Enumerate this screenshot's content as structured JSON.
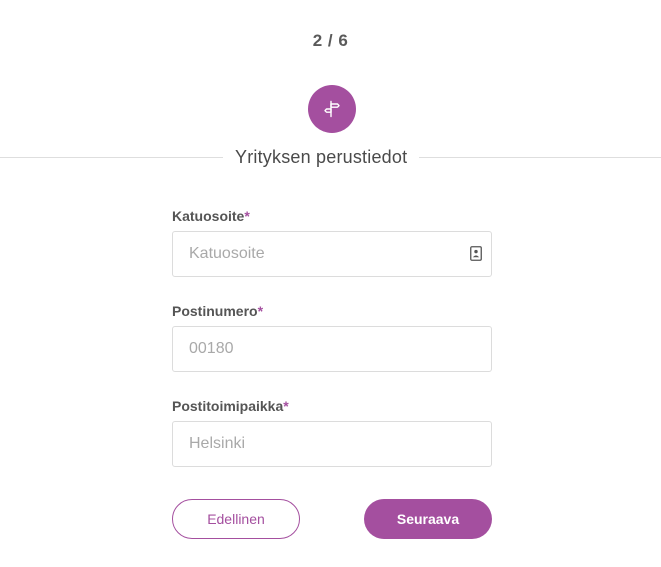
{
  "progress": {
    "step_text": "2 / 6",
    "current_step": 2,
    "total_steps": 6
  },
  "section": {
    "icon": "signpost-icon",
    "title": "Yrityksen perustiedot"
  },
  "fields": {
    "street": {
      "label": "Katuosoite",
      "required_mark": "*",
      "placeholder": "Katuosoite",
      "icon": "contact-card-icon"
    },
    "postal_code": {
      "label": "Postinumero",
      "required_mark": "*",
      "placeholder": "00180"
    },
    "city": {
      "label": "Postitoimipaikka",
      "required_mark": "*",
      "placeholder": "Helsinki"
    }
  },
  "buttons": {
    "previous_label": "Edellinen",
    "next_label": "Seuraava"
  },
  "colors": {
    "accent": "#a44f9f",
    "divider": "#dedede",
    "input_border": "#dcdcdc",
    "placeholder": "#a9a9a9"
  }
}
